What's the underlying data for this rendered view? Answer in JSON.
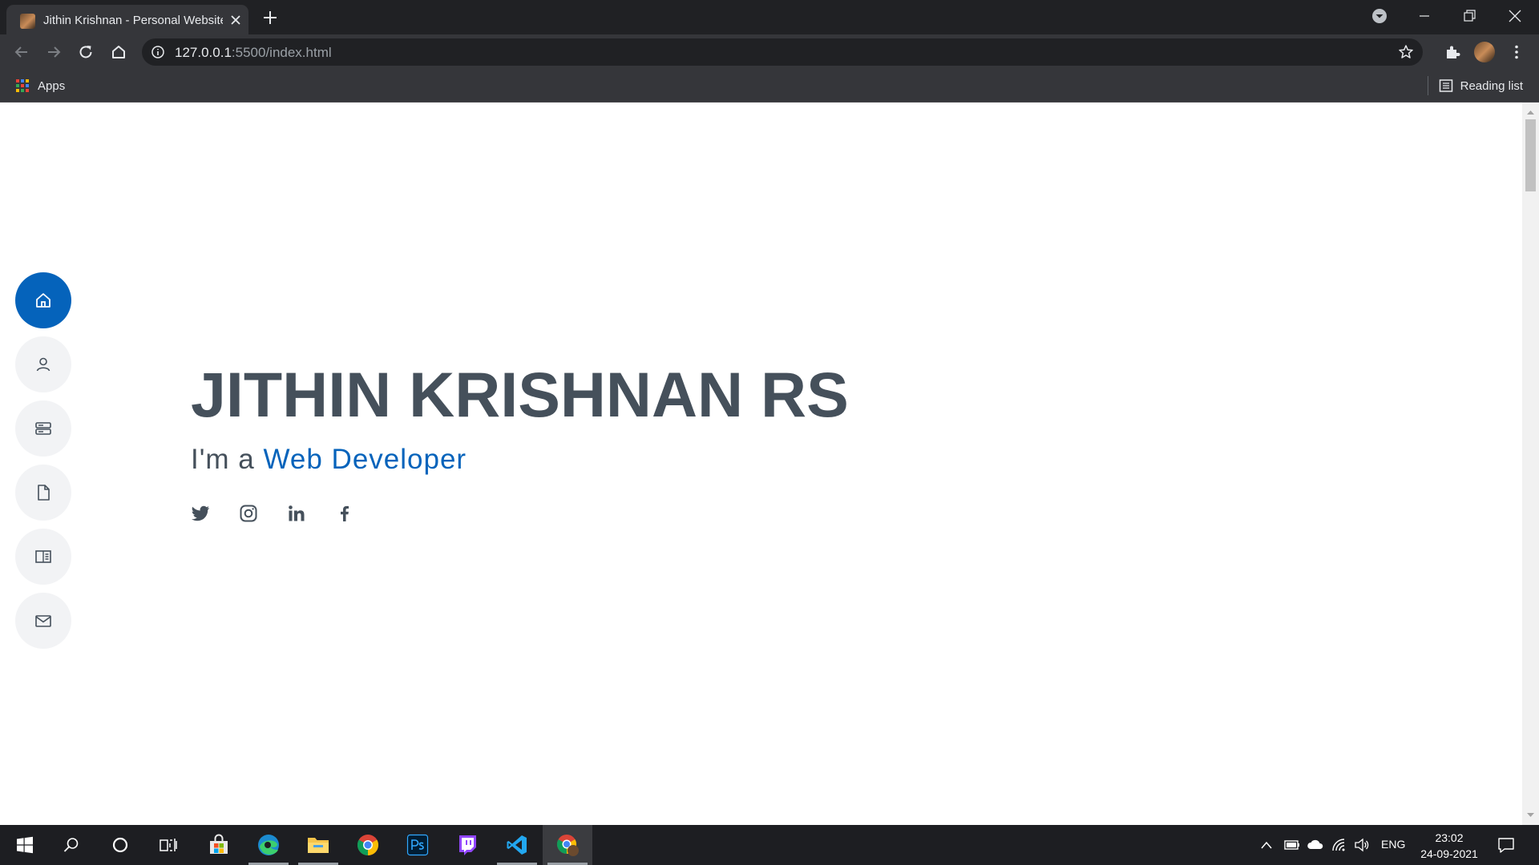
{
  "browser": {
    "tab": {
      "title": "Jithin Krishnan - Personal Website",
      "favicon": "profile-photo-icon"
    },
    "url": {
      "host": "127.0.0.1",
      "rest": ":5500/index.html"
    },
    "bookmarks": {
      "apps_label": "Apps",
      "reading_list_label": "Reading list"
    }
  },
  "page": {
    "side_nav": [
      {
        "name": "home",
        "icon": "home-icon",
        "active": true
      },
      {
        "name": "about",
        "icon": "person-icon",
        "active": false
      },
      {
        "name": "resume",
        "icon": "server-icon",
        "active": false
      },
      {
        "name": "portfolio",
        "icon": "file-icon",
        "active": false
      },
      {
        "name": "services",
        "icon": "book-half-icon",
        "active": false
      },
      {
        "name": "contact",
        "icon": "envelope-icon",
        "active": false
      }
    ],
    "hero": {
      "name": "JITHIN KRISHNAN RS",
      "intro": "I'm a ",
      "role": "Web Developer"
    },
    "socials": [
      "twitter-icon",
      "instagram-icon",
      "linkedin-icon",
      "facebook-icon"
    ],
    "accent_color": "#0563bb",
    "text_color": "#45505b"
  },
  "taskbar": {
    "apps": [
      "start-icon",
      "search-icon",
      "cortana-icon",
      "task-view-icon",
      "store-icon",
      "edge-icon",
      "file-explorer-icon",
      "chrome-icon",
      "photoshop-icon",
      "twitch-icon",
      "vscode-icon",
      "chrome-profile-icon"
    ],
    "language": "ENG",
    "time": "23:02",
    "date": "24-09-2021"
  }
}
